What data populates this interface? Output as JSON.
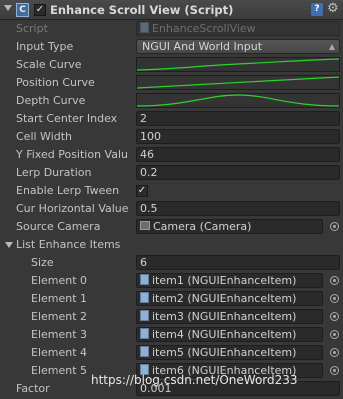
{
  "header": {
    "title": "Enhance Scroll View (Script)",
    "enabled": "✓",
    "help_icon": "?"
  },
  "fields": {
    "script": {
      "label": "Script",
      "value": "EnhanceScrollView"
    },
    "input_type": {
      "label": "Input Type",
      "value": "NGUI And World Input"
    },
    "scale_curve": {
      "label": "Scale Curve"
    },
    "position_curve": {
      "label": "Position Curve"
    },
    "depth_curve": {
      "label": "Depth Curve"
    },
    "start_center_index": {
      "label": "Start Center Index",
      "value": "2"
    },
    "cell_width": {
      "label": "Cell Width",
      "value": "100"
    },
    "y_fixed_position": {
      "label": "Y Fixed Position Valu",
      "value": "46"
    },
    "lerp_duration": {
      "label": "Lerp Duration",
      "value": "0.2"
    },
    "enable_lerp_tween": {
      "label": "Enable Lerp Tween",
      "value": "✓"
    },
    "cur_horizontal_value": {
      "label": "Cur Horizontal Value",
      "value": "0.5"
    },
    "source_camera": {
      "label": "Source Camera",
      "value": "Camera (Camera)"
    },
    "list": {
      "label": "List Enhance Items",
      "size_label": "Size",
      "size_value": "6",
      "elements": [
        {
          "label": "Element 0",
          "value": "item1 (NGUIEnhanceItem)"
        },
        {
          "label": "Element 1",
          "value": "item2 (NGUIEnhanceItem)"
        },
        {
          "label": "Element 2",
          "value": "item3 (NGUIEnhanceItem)"
        },
        {
          "label": "Element 3",
          "value": "item4 (NGUIEnhanceItem)"
        },
        {
          "label": "Element 4",
          "value": "item5 (NGUIEnhanceItem)"
        },
        {
          "label": "Element 5",
          "value": "item6 (NGUIEnhanceItem)"
        }
      ]
    },
    "factor": {
      "label": "Factor",
      "value": "0.001"
    }
  },
  "watermark": "https://blog.csdn.net/OneWord233",
  "colors": {
    "background": "#383838",
    "field": "#2a2a2a",
    "curve": "#2bd42b",
    "text": "#c4c4c4"
  }
}
